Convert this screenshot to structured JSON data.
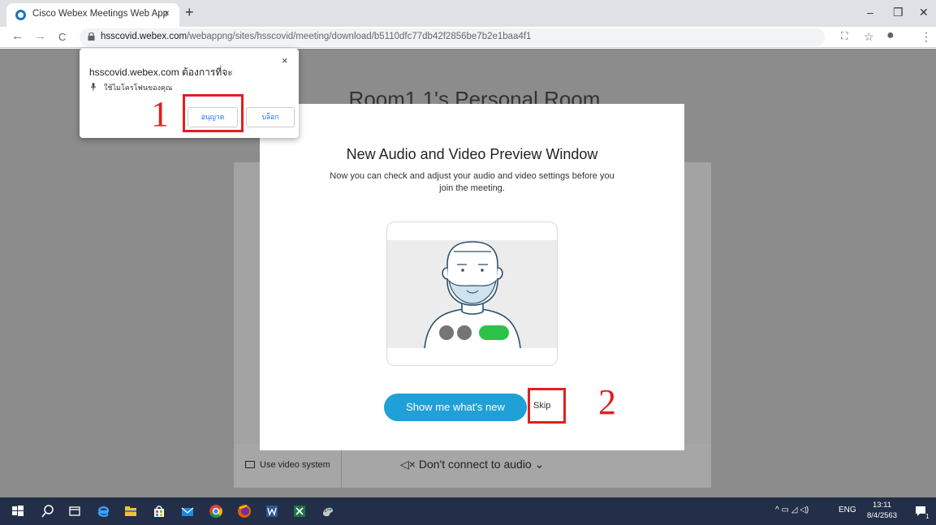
{
  "browser": {
    "tab_title": "Cisco Webex Meetings Web App",
    "tab_close": "×",
    "new_tab": "+",
    "url_host": "hsscovid.webex.com",
    "url_path": "/webappng/sites/hsscovid/meeting/download/b5110dfc77db42f2856be7b2e1baa4f1",
    "window_controls": {
      "minimize": "–",
      "restore": "❐",
      "close": "✕"
    },
    "nav": {
      "back": "←",
      "forward": "→",
      "reload": "C"
    },
    "tools": {
      "translate": "⛶",
      "star": "☆",
      "profile": "●",
      "menu": "⋮"
    }
  },
  "permission_popup": {
    "title": "hsscovid.webex.com ต้องการที่จะ",
    "request": "ใช้ไมโครโฟนของคุณ",
    "allow_label": "อนุญาต",
    "block_label": "บล็อก",
    "close": "×",
    "annotation_number": "1"
  },
  "page": {
    "room_title": "Room1 1's Personal Room",
    "use_video_system": "Use video system",
    "audio_option": "◁× Don't connect to audio ⌄"
  },
  "modal": {
    "title": "New Audio and Video Preview Window",
    "subtitle": "Now you can check and adjust your audio and video settings before you join the meeting.",
    "primary_button": "Show me what's new",
    "skip_button": "Skip",
    "annotation_number": "2"
  },
  "taskbar": {
    "tray_language": "ENG",
    "tray_icons": "^ ▭ ◿ ◁)",
    "clock_time": "13:11",
    "clock_date": "8/4/2563",
    "notification": "1"
  },
  "colors": {
    "accent_blue": "#1fa0d6",
    "annotation_red": "#e02020",
    "taskbar": "#232f48"
  }
}
